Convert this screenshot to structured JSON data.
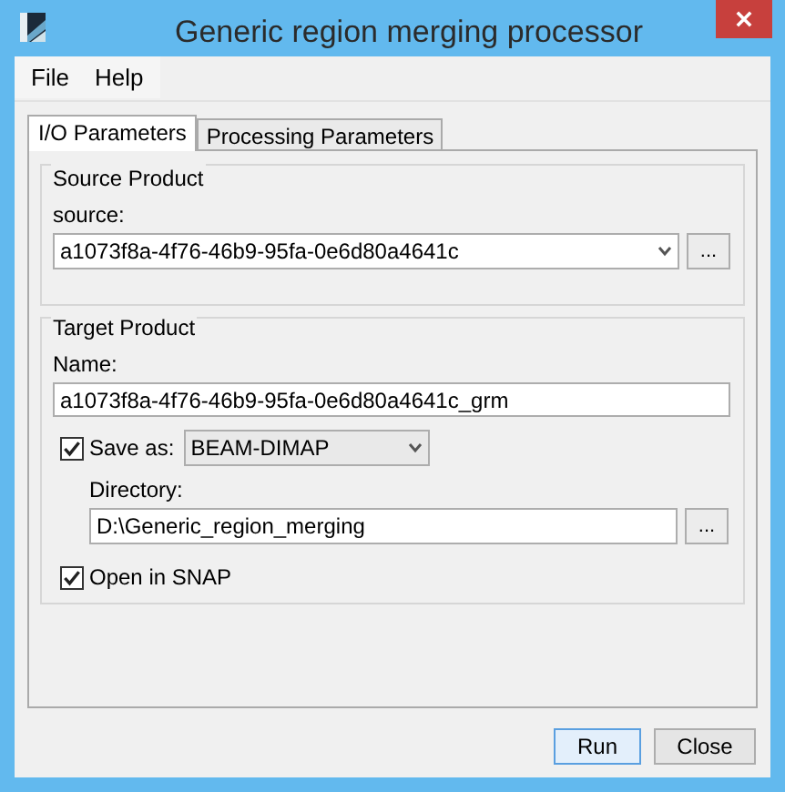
{
  "window": {
    "title": "Generic region merging processor"
  },
  "menu": [
    {
      "label": "File"
    },
    {
      "label": "Help"
    }
  ],
  "tabs": [
    {
      "label": "I/O Parameters",
      "selected": true
    },
    {
      "label": "Processing Parameters",
      "selected": false
    }
  ],
  "source_product": {
    "title": "Source Product",
    "label": "source:",
    "value": "a1073f8a-4f76-46b9-95fa-0e6d80a4641c",
    "browse": "..."
  },
  "target_product": {
    "title": "Target Product",
    "name_label": "Name:",
    "name_value": "a1073f8a-4f76-46b9-95fa-0e6d80a4641c_grm",
    "save_as": {
      "label": "Save as:",
      "checked": true,
      "format": "BEAM-DIMAP"
    },
    "directory_label": "Directory:",
    "directory_value": "D:\\Generic_region_merging",
    "browse": "...",
    "open_in_snap": {
      "label": "Open in SNAP",
      "checked": true
    }
  },
  "buttons": [
    {
      "label": "Run",
      "focused": true
    },
    {
      "label": "Close",
      "focused": false
    }
  ]
}
